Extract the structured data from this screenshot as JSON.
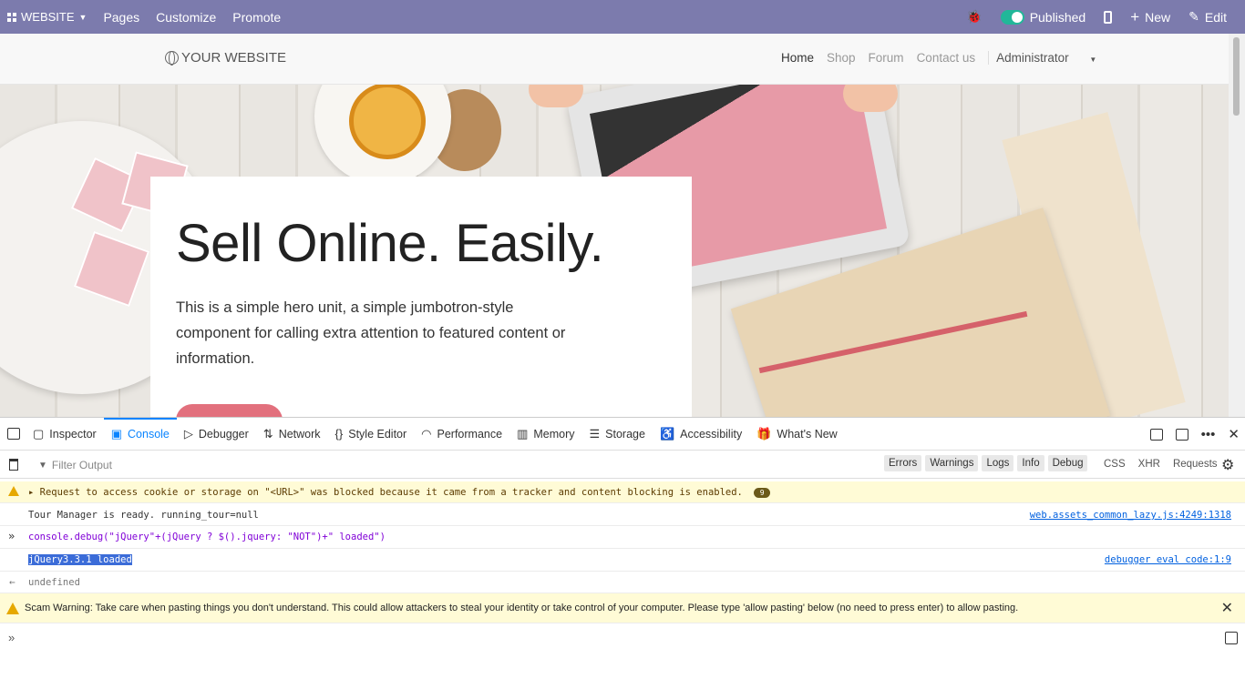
{
  "adminbar": {
    "brand": "WEBSITE",
    "menu": [
      "Pages",
      "Customize",
      "Promote"
    ],
    "published_label": "Published",
    "new_label": "New",
    "edit_label": "Edit",
    "icons": {
      "bug": "bug-icon",
      "published": "toggle-icon",
      "mobile": "mobile-preview-icon",
      "new": "plus-icon",
      "edit": "pencil-icon"
    }
  },
  "site": {
    "logo_text": "YOUR WEBSITE",
    "nav": [
      "Home",
      "Shop",
      "Forum",
      "Contact us"
    ],
    "user": "Administrator"
  },
  "hero": {
    "title": "Sell Online. Easily.",
    "description": "This is a simple hero unit, a simple jumbotron-style component for calling extra attention to featured content or information."
  },
  "devtools": {
    "tabs": [
      {
        "label": "Inspector",
        "icon": "inspector-icon"
      },
      {
        "label": "Console",
        "icon": "console-icon",
        "active": true
      },
      {
        "label": "Debugger",
        "icon": "debugger-icon"
      },
      {
        "label": "Network",
        "icon": "network-icon"
      },
      {
        "label": "Style Editor",
        "icon": "style-editor-icon"
      },
      {
        "label": "Performance",
        "icon": "performance-icon"
      },
      {
        "label": "Memory",
        "icon": "memory-icon"
      },
      {
        "label": "Storage",
        "icon": "storage-icon"
      },
      {
        "label": "Accessibility",
        "icon": "accessibility-icon"
      },
      {
        "label": "What's New",
        "icon": "gift-icon"
      }
    ],
    "filter_placeholder": "Filter Output",
    "levels": [
      "Errors",
      "Warnings",
      "Logs",
      "Info",
      "Debug"
    ],
    "request_filters": [
      "CSS",
      "XHR",
      "Requests"
    ],
    "messages": {
      "warning": "Request to access cookie or storage on \"<URL>\" was blocked because it came from a tracker and content blocking is enabled.",
      "warning_count": "9",
      "tour": "Tour Manager is ready.  running_tour=null",
      "tour_source": "web.assets_common_lazy.js:4249:1318",
      "command": "console.debug(\"jQuery\"+(jQuery ? $().jquery: \"NOT\")+\" loaded\")",
      "result": "jQuery3.3.1 loaded",
      "result_source": "debugger eval code:1:9",
      "return_value": "undefined"
    },
    "scam_warning": "Scam Warning: Take care when pasting things you don't understand. This could allow attackers to steal your identity or take control of your computer. Please type 'allow pasting' below (no need to press enter) to allow pasting.",
    "accent": "#0a84ff"
  },
  "colors": {
    "adminbar": "#7c7bad",
    "published_toggle": "#21b799",
    "hero_button": "#e2707d"
  }
}
